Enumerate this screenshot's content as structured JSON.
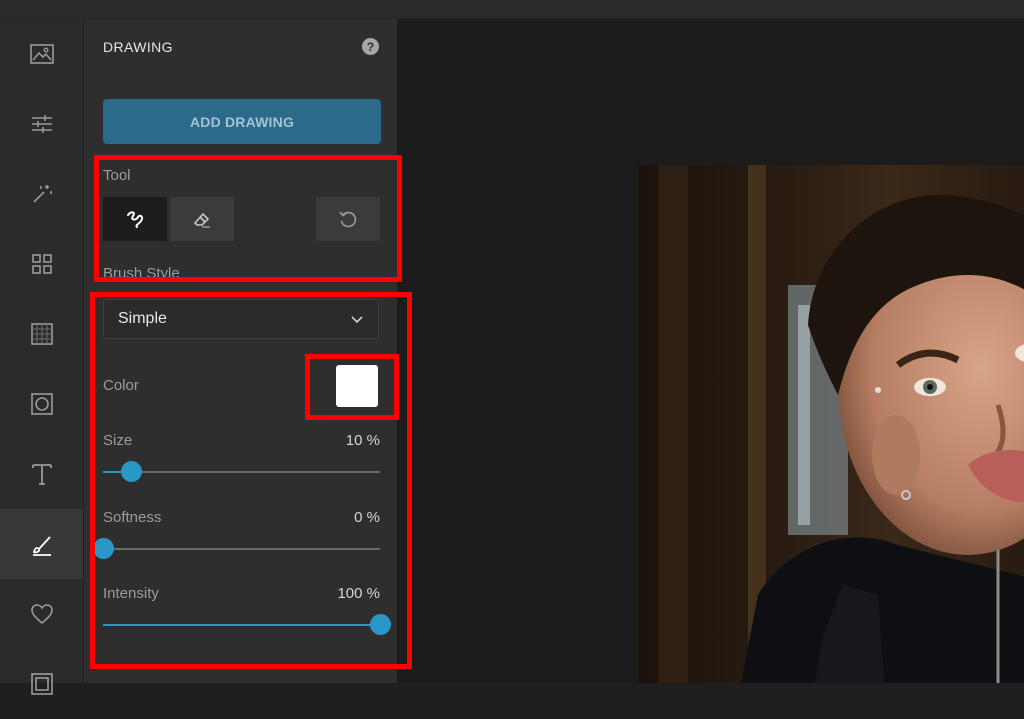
{
  "panel": {
    "title": "DRAWING",
    "help_glyph": "?",
    "add_button": "ADD DRAWING"
  },
  "rail_icons": [
    "image-icon",
    "sliders-icon",
    "magic-wand-icon",
    "grid-icon",
    "texture-icon",
    "frame-icon",
    "text-icon",
    "brush-icon",
    "heart-icon",
    "overlay-icon"
  ],
  "tool": {
    "label": "Tool",
    "buttons": [
      "brush-icon",
      "eraser-icon",
      "undo-icon"
    ]
  },
  "brush_style": {
    "label": "Brush Style",
    "selected": "Simple"
  },
  "color": {
    "label": "Color",
    "value": "#ffffff"
  },
  "size": {
    "label": "Size",
    "value_text": "10 %",
    "value": 10
  },
  "softness": {
    "label": "Softness",
    "value_text": "0 %",
    "value": 0
  },
  "intensity": {
    "label": "Intensity",
    "value_text": "100 %",
    "value": 100
  },
  "colors": {
    "accent": "#2a97c9",
    "button": "#2c6a8c",
    "highlight": "#ff0000"
  }
}
